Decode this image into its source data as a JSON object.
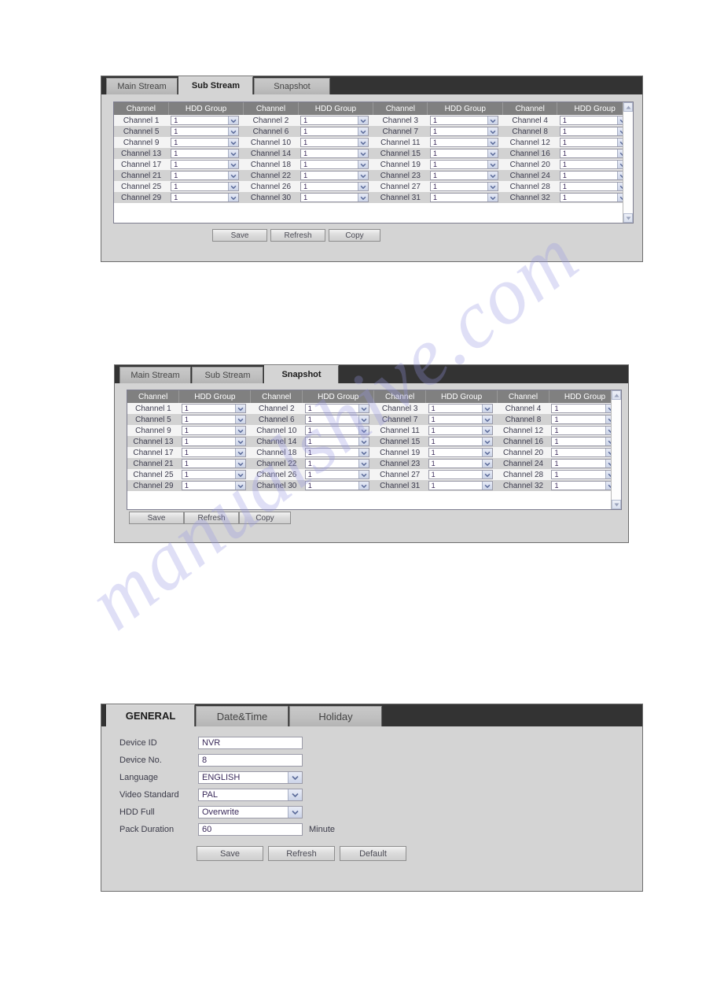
{
  "watermark": {
    "text": "manualshive.com"
  },
  "panels": [
    {
      "id": "sub-stream-panel",
      "tabs": [
        {
          "label": "Main Stream",
          "active": false
        },
        {
          "label": "Sub Stream",
          "active": true
        },
        {
          "label": "Snapshot",
          "active": false
        }
      ],
      "table": {
        "headers": [
          "Channel",
          "HDD Group",
          "Channel",
          "HDD Group",
          "Channel",
          "HDD Group",
          "Channel",
          "HDD Group"
        ],
        "rows": [
          [
            "Channel 1",
            "1",
            "Channel 2",
            "1",
            "Channel 3",
            "1",
            "Channel 4",
            "1"
          ],
          [
            "Channel 5",
            "1",
            "Channel 6",
            "1",
            "Channel 7",
            "1",
            "Channel 8",
            "1"
          ],
          [
            "Channel 9",
            "1",
            "Channel 10",
            "1",
            "Channel 11",
            "1",
            "Channel 12",
            "1"
          ],
          [
            "Channel 13",
            "1",
            "Channel 14",
            "1",
            "Channel 15",
            "1",
            "Channel 16",
            "1"
          ],
          [
            "Channel 17",
            "1",
            "Channel 18",
            "1",
            "Channel 19",
            "1",
            "Channel 20",
            "1"
          ],
          [
            "Channel 21",
            "1",
            "Channel 22",
            "1",
            "Channel 23",
            "1",
            "Channel 24",
            "1"
          ],
          [
            "Channel 25",
            "1",
            "Channel 26",
            "1",
            "Channel 27",
            "1",
            "Channel 28",
            "1"
          ],
          [
            "Channel 29",
            "1",
            "Channel 30",
            "1",
            "Channel 31",
            "1",
            "Channel 32",
            "1"
          ]
        ]
      },
      "buttons": [
        "Save",
        "Refresh",
        "Copy"
      ]
    },
    {
      "id": "snapshot-panel",
      "tabs": [
        {
          "label": "Main Stream",
          "active": false
        },
        {
          "label": "Sub Stream",
          "active": false
        },
        {
          "label": "Snapshot",
          "active": true
        }
      ],
      "table": {
        "headers": [
          "Channel",
          "HDD Group",
          "Channel",
          "HDD Group",
          "Channel",
          "HDD Group",
          "Channel",
          "HDD Group"
        ],
        "rows": [
          [
            "Channel 1",
            "1",
            "Channel 2",
            "1",
            "Channel 3",
            "1",
            "Channel 4",
            "1"
          ],
          [
            "Channel 5",
            "1",
            "Channel 6",
            "1",
            "Channel 7",
            "1",
            "Channel 8",
            "1"
          ],
          [
            "Channel 9",
            "1",
            "Channel 10",
            "1",
            "Channel 11",
            "1",
            "Channel 12",
            "1"
          ],
          [
            "Channel 13",
            "1",
            "Channel 14",
            "1",
            "Channel 15",
            "1",
            "Channel 16",
            "1"
          ],
          [
            "Channel 17",
            "1",
            "Channel 18",
            "1",
            "Channel 19",
            "1",
            "Channel 20",
            "1"
          ],
          [
            "Channel 21",
            "1",
            "Channel 22",
            "1",
            "Channel 23",
            "1",
            "Channel 24",
            "1"
          ],
          [
            "Channel 25",
            "1",
            "Channel 26",
            "1",
            "Channel 27",
            "1",
            "Channel 28",
            "1"
          ],
          [
            "Channel 29",
            "1",
            "Channel 30",
            "1",
            "Channel 31",
            "1",
            "Channel 32",
            "1"
          ]
        ]
      },
      "buttons": [
        "Save",
        "Refresh",
        "Copy"
      ]
    }
  ],
  "general": {
    "tabs": [
      {
        "label": "GENERAL",
        "active": true
      },
      {
        "label": "Date&Time",
        "active": false
      },
      {
        "label": "Holiday",
        "active": false
      }
    ],
    "fields": [
      {
        "label": "Device ID",
        "value": "NVR",
        "type": "text",
        "unit": ""
      },
      {
        "label": "Device No.",
        "value": "8",
        "type": "text",
        "unit": ""
      },
      {
        "label": "Language",
        "value": "ENGLISH",
        "type": "select",
        "unit": ""
      },
      {
        "label": "Video Standard",
        "value": "PAL",
        "type": "select",
        "unit": ""
      },
      {
        "label": "HDD Full",
        "value": "Overwrite",
        "type": "select",
        "unit": ""
      },
      {
        "label": "Pack Duration",
        "value": "60",
        "type": "text",
        "unit": "Minute"
      }
    ],
    "buttons": [
      "Save",
      "Refresh",
      "Default"
    ]
  },
  "icons": {
    "dropdown": "chevron-down-icon",
    "scroll_up": "scroll-up-arrow-icon",
    "scroll_down": "scroll-down-arrow-icon"
  }
}
